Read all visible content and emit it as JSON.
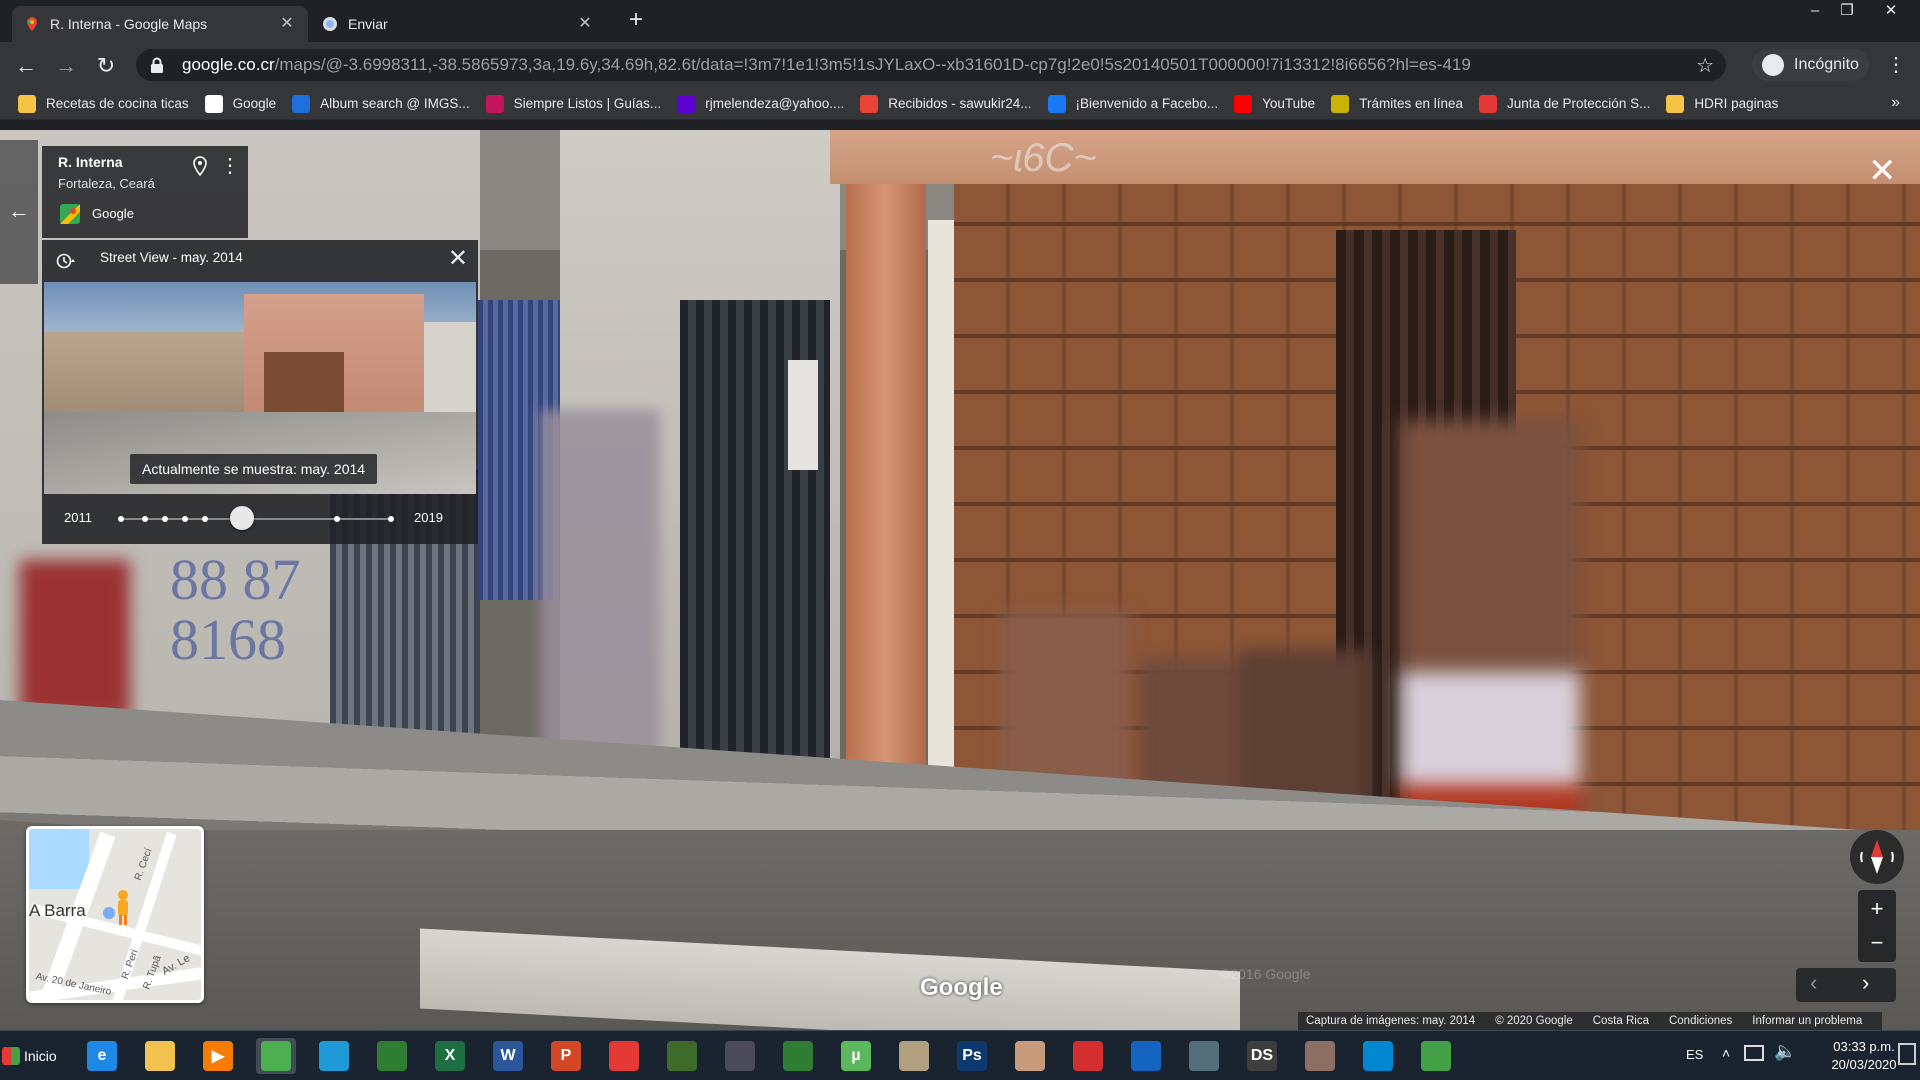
{
  "browser": {
    "tabs": [
      {
        "title": "R. Interna - Google Maps",
        "active": true
      },
      {
        "title": "Enviar",
        "active": false
      }
    ],
    "url": {
      "host": "google.co.cr",
      "rest": "/maps/@-3.6998311,-38.5865973,3a,19.6y,34.69h,82.6t/data=!3m7!1e1!3m5!1sJYLaxO--xb31601D-cp7g!2e0!5s20140501T000000!7i13312!8i6656?hl=es-419"
    },
    "incognito_label": "Incógnito",
    "bookmarks": [
      {
        "label": "Recetas de cocina ticas",
        "icon": "folder-icon",
        "color": "#f6c445"
      },
      {
        "label": "Google",
        "icon": "google-icon",
        "color": "#ffffff"
      },
      {
        "label": "Album search @ IMGS...",
        "icon": "imgsrc-icon",
        "color": "#1e6fd9"
      },
      {
        "label": "Siempre Listos | Guías...",
        "icon": "scout-icon",
        "color": "#c2185b"
      },
      {
        "label": "rjmelendeza@yahoo....",
        "icon": "yahoo-icon",
        "color": "#5f01d1"
      },
      {
        "label": "Recibidos - sawukir24...",
        "icon": "gmail-icon",
        "color": "#ea4335"
      },
      {
        "label": "¡Bienvenido a Facebo...",
        "icon": "facebook-icon",
        "color": "#1877f2"
      },
      {
        "label": "YouTube",
        "icon": "youtube-icon",
        "color": "#ff0000"
      },
      {
        "label": "Trámites en línea",
        "icon": "tramites-icon",
        "color": "#c8b400"
      },
      {
        "label": "Junta de Protección S...",
        "icon": "jps-icon",
        "color": "#e53935"
      },
      {
        "label": "HDRI paginas",
        "icon": "folder-icon",
        "color": "#f6c445"
      }
    ],
    "more_bookmarks": "»"
  },
  "maps": {
    "place": {
      "name": "R. Interna",
      "subtitle": "Fortaleza, Ceará",
      "source": "Google"
    },
    "time_machine": {
      "title": "Street View - may. 2014",
      "caption": "Actualmente se muestra: may. 2014",
      "start_year": "2011",
      "end_year": "2019",
      "selected_fraction": 0.45
    },
    "minimap_label": "A Barra",
    "minimap_streets": [
      "R. Cecí",
      "Av. Le",
      "R. Peri",
      "R. Tupã",
      "Av. 20 de Janeiro"
    ],
    "watermark": "Google",
    "faint_watermark": "©2016 Google",
    "attribution": [
      "Captura de imágenes: may. 2014",
      "© 2020 Google",
      "Costa Rica",
      "Condiciones",
      "Informar un problema"
    ]
  },
  "taskbar": {
    "start_label": "Inicio",
    "apps": [
      {
        "name": "internet-explorer",
        "glyph": "e",
        "color": "#1e88e5"
      },
      {
        "name": "file-explorer",
        "glyph": "",
        "color": "#f2c14e"
      },
      {
        "name": "media-player",
        "glyph": "▶",
        "color": "#f57c00"
      },
      {
        "name": "chrome",
        "glyph": "",
        "color": "#4caf50"
      },
      {
        "name": "app-blue",
        "glyph": "",
        "color": "#1e9bd7"
      },
      {
        "name": "app-green-pc",
        "glyph": "",
        "color": "#2e7d32"
      },
      {
        "name": "excel",
        "glyph": "X",
        "color": "#1d6f42"
      },
      {
        "name": "word",
        "glyph": "W",
        "color": "#2b579a"
      },
      {
        "name": "powerpoint",
        "glyph": "P",
        "color": "#d24726"
      },
      {
        "name": "acrobat",
        "glyph": "",
        "color": "#e53935"
      },
      {
        "name": "game-green",
        "glyph": "",
        "color": "#3f6b2a"
      },
      {
        "name": "game-dark",
        "glyph": "",
        "color": "#4a4a5a"
      },
      {
        "name": "globe-app",
        "glyph": "",
        "color": "#2e7d32"
      },
      {
        "name": "utorrent",
        "glyph": "µ",
        "color": "#5cb85c"
      },
      {
        "name": "app-rabbit",
        "glyph": "",
        "color": "#b0a080"
      },
      {
        "name": "photoshop",
        "glyph": "Ps",
        "color": "#0d3a6e"
      },
      {
        "name": "app-face",
        "glyph": "",
        "color": "#c79a7c"
      },
      {
        "name": "sketchup",
        "glyph": "",
        "color": "#d32f2f"
      },
      {
        "name": "app-fan",
        "glyph": "",
        "color": "#1565c0"
      },
      {
        "name": "app-speaker",
        "glyph": "",
        "color": "#546e7a"
      },
      {
        "name": "daz-studio",
        "glyph": "DS",
        "color": "#3e3e3e"
      },
      {
        "name": "app-creature",
        "glyph": "",
        "color": "#8d6e63"
      },
      {
        "name": "app-disc",
        "glyph": "",
        "color": "#0288d1"
      },
      {
        "name": "app-figure",
        "glyph": "",
        "color": "#43a047"
      }
    ],
    "language": "ES",
    "time": "03:33 p.m.",
    "date": "20/03/2020"
  }
}
